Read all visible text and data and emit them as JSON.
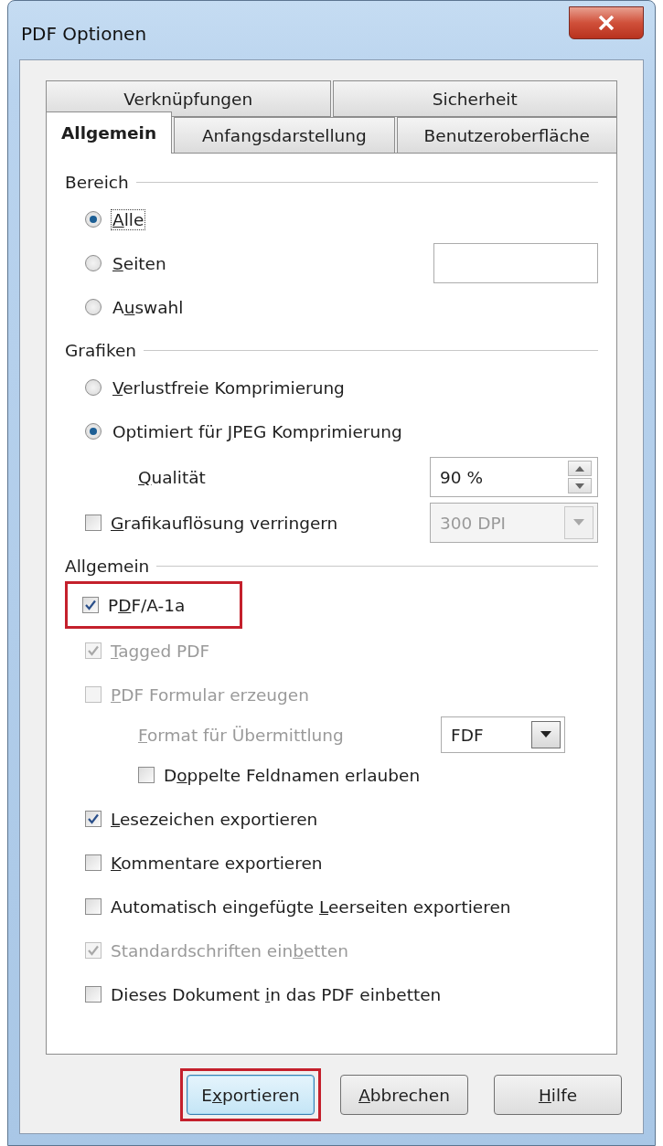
{
  "window": {
    "title": "PDF Optionen"
  },
  "tab_rows": [
    {
      "tabs": [
        {
          "label": "Verknüpfungen",
          "selected": false
        },
        {
          "label": "Sicherheit",
          "selected": false
        }
      ]
    },
    {
      "tabs": [
        {
          "label": "Allgemein",
          "selected": true
        },
        {
          "label": "Anfangsdarstellung",
          "selected": false
        },
        {
          "label": "Benutzeroberfläche",
          "selected": false
        }
      ]
    }
  ],
  "sections": [
    {
      "title": "Bereich",
      "items": [
        {
          "kind": "radio",
          "label": {
            "key": "A",
            "post": "lle"
          },
          "selected": true,
          "focused": true
        },
        {
          "kind": "radio_field",
          "label": {
            "key": "S",
            "post": "eiten"
          },
          "selected": false,
          "focused": false
        },
        {
          "kind": "radio",
          "label": {
            "pre": "A",
            "key": "u",
            "post": "swahl"
          },
          "selected": false,
          "focused": false
        }
      ]
    },
    {
      "title": "Grafiken",
      "items": [
        {
          "kind": "radio",
          "label": {
            "key": "V",
            "post": "erlustfreie Komprimierung"
          },
          "selected": false,
          "focused": false
        },
        {
          "kind": "radio",
          "label": {
            "pre": "Optimiert für ",
            "key": "J",
            "post": "PEG Komprimierung"
          },
          "selected": true,
          "focused": false,
          "children": [
            {
              "kind": "spin",
              "label": {
                "key": "Q",
                "post": "ualität"
              },
              "value": "90 %"
            }
          ]
        },
        {
          "kind": "checkbox",
          "label": {
            "key": "G",
            "post": "rafikauflösung verringern"
          },
          "checked": false,
          "disabled": false,
          "highlighted": false,
          "select": {
            "value": "300 DPI",
            "disabled": true
          }
        }
      ]
    },
    {
      "title": "Allgemein",
      "items": [
        {
          "kind": "checkbox",
          "label": {
            "pre": "P",
            "key": "D",
            "post": "F/A-1a"
          },
          "checked": true,
          "disabled": false,
          "highlighted": true
        },
        {
          "kind": "checkbox",
          "label": {
            "key": "T",
            "post": "agged PDF"
          },
          "checked": true,
          "disabled": true,
          "highlighted": false
        },
        {
          "kind": "checkbox",
          "label": {
            "key": "P",
            "post": "DF Formular erzeugen"
          },
          "checked": false,
          "disabled": true,
          "highlighted": false,
          "children": [
            {
              "kind": "select",
              "label": {
                "key": "F",
                "post": "ormat für Übermittlung"
              },
              "disabled": true,
              "select": {
                "value": "FDF",
                "disabled": false
              }
            },
            {
              "kind": "checkbox",
              "label": {
                "pre": "D",
                "key": "o",
                "post": "ppelte Feldnamen erlauben"
              },
              "checked": false,
              "disabled": false,
              "highlighted": false
            }
          ]
        },
        {
          "kind": "checkbox",
          "label": {
            "key": "L",
            "post": "esezeichen exportieren"
          },
          "checked": true,
          "disabled": false,
          "highlighted": false
        },
        {
          "kind": "checkbox",
          "label": {
            "key": "K",
            "post": "ommentare exportieren"
          },
          "checked": false,
          "disabled": false,
          "highlighted": false
        },
        {
          "kind": "checkbox",
          "label": {
            "pre": "Automatisch eingefügte ",
            "key": "L",
            "post": "eerseiten exportieren"
          },
          "checked": false,
          "disabled": false,
          "highlighted": false
        },
        {
          "kind": "checkbox",
          "label": {
            "pre": "Standardschriften ein",
            "key": "b",
            "post": "etten"
          },
          "checked": true,
          "disabled": true,
          "highlighted": false
        },
        {
          "kind": "checkbox",
          "label": {
            "pre": "Dieses Dokument ",
            "key": "i",
            "post": "n das PDF einbetten"
          },
          "checked": false,
          "disabled": false,
          "highlighted": false
        }
      ]
    }
  ],
  "buttons": [
    {
      "label": {
        "pre": "E",
        "key": "x",
        "post": "portieren"
      },
      "default": true,
      "highlighted": true
    },
    {
      "label": {
        "key": "A",
        "post": "bbrechen"
      },
      "default": false,
      "highlighted": false
    },
    {
      "label": {
        "key": "H",
        "post": "ilfe"
      },
      "default": false,
      "highlighted": false
    }
  ]
}
